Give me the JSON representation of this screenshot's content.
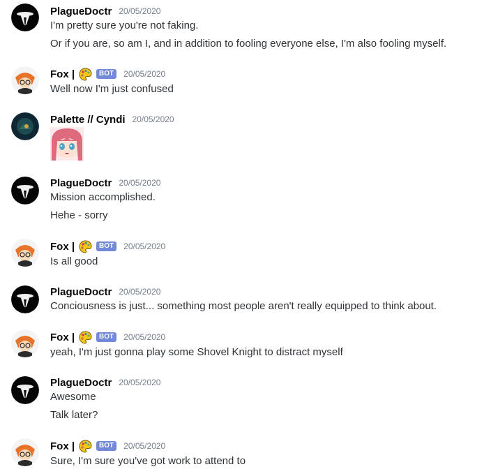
{
  "messages": [
    {
      "author": "PlagueDoctr",
      "timestamp": "20/05/2020",
      "bot": false,
      "avatar": "plague-doctor-avatar",
      "lines": [
        "I'm pretty sure you're not faking.",
        "Or if you are, so am I, and in addition to fooling everyone else, I'm also fooling myself."
      ]
    },
    {
      "author": "Fox |",
      "timestamp": "20/05/2020",
      "bot": true,
      "bot_label": "BOT",
      "avatar": "fox-avatar",
      "lines": [
        "Well now I'm just confused"
      ]
    },
    {
      "author": "Palette // Cyndi",
      "timestamp": "20/05/2020",
      "bot": false,
      "avatar": "palette-avatar",
      "lines": [],
      "attachment": "anime-girl-emote"
    },
    {
      "author": "PlagueDoctr",
      "timestamp": "20/05/2020",
      "bot": false,
      "avatar": "plague-doctor-avatar",
      "lines": [
        "Mission accomplished.",
        "Hehe - sorry"
      ]
    },
    {
      "author": "Fox |",
      "timestamp": "20/05/2020",
      "bot": true,
      "bot_label": "BOT",
      "avatar": "fox-avatar",
      "lines": [
        "Is all good"
      ]
    },
    {
      "author": "PlagueDoctr",
      "timestamp": "20/05/2020",
      "bot": false,
      "avatar": "plague-doctor-avatar",
      "lines": [
        "Conciousness is just... something most people aren't really equipped to think about."
      ]
    },
    {
      "author": "Fox |",
      "timestamp": "20/05/2020",
      "bot": true,
      "bot_label": "BOT",
      "avatar": "fox-avatar",
      "lines": [
        "yeah, I'm just gonna play some Shovel Knight to distract myself"
      ]
    },
    {
      "author": "PlagueDoctr",
      "timestamp": "20/05/2020",
      "bot": false,
      "avatar": "plague-doctor-avatar",
      "lines": [
        "Awesome",
        "Talk later?"
      ]
    },
    {
      "author": "Fox |",
      "timestamp": "20/05/2020",
      "bot": true,
      "bot_label": "BOT",
      "avatar": "fox-avatar",
      "lines": [
        "Sure, I'm sure you've got work to attend to"
      ]
    }
  ],
  "colors": {
    "bot_badge": "#7289da",
    "timestamp": "#747f8d",
    "author": "#060607",
    "text": "#2e3338"
  }
}
